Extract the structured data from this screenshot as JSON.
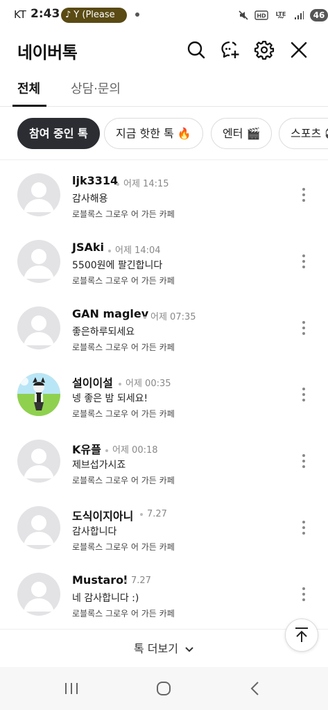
{
  "status_bar": {
    "carrier": "KT",
    "time": "2:43",
    "media_pill": "Y (Please",
    "battery": "46"
  },
  "header": {
    "title": "네이버톡",
    "icons": [
      "search-icon",
      "new-chat-icon",
      "settings-icon",
      "close-icon"
    ]
  },
  "tabs": [
    {
      "label": "전체",
      "active": true
    },
    {
      "label": "상담·문의",
      "active": false
    }
  ],
  "chips": [
    {
      "label": "참여 중인 톡",
      "selected": true
    },
    {
      "label": "지금 핫한 톡 🔥",
      "selected": false
    },
    {
      "label": "엔터 🎬",
      "selected": false
    },
    {
      "label": "스포츠 ⚽",
      "selected": false
    }
  ],
  "chats": [
    {
      "name": "ljk3314",
      "time": "어제 14:15",
      "message": "감사해용",
      "cafe": "로블록스 그로우 어 가든 카페",
      "avatar": "default"
    },
    {
      "name": "JSAki",
      "time": "어제 14:04",
      "message": "5500원에 팔긴합니다",
      "cafe": "로블록스 그로우 어 가든 카페",
      "avatar": "default"
    },
    {
      "name": "GAN maglev",
      "time": "어제 07:35",
      "message": "좋은하루되세요",
      "cafe": "로블록스 그로우 어 가든 카페",
      "avatar": "default"
    },
    {
      "name": "설이이설",
      "time": "어제 00:35",
      "message": "넹 좋은 밤 되세요!",
      "cafe": "로블록스 그로우 어 가든 카페",
      "avatar": "custom"
    },
    {
      "name": "K유플",
      "time": "어제 00:18",
      "message": "제브섭가시죠",
      "cafe": "로블록스 그로우 어 가든 카페",
      "avatar": "default"
    },
    {
      "name": "도식이지아니",
      "time": "7.27",
      "message": "감사합니다",
      "cafe": "로블록스 그로우 어 가든 카페",
      "avatar": "default"
    },
    {
      "name": "Mustarol",
      "time": "7.27",
      "message": "네 감사합니다 :)",
      "cafe": "로블록스 그로우 어 가든 카페",
      "avatar": "default"
    }
  ],
  "load_more": {
    "label": "톡 더보기"
  },
  "colors": {
    "selected_chip": "#2b2d33",
    "avatar_placeholder": "#e3e3e6",
    "meta_text": "#888888"
  }
}
